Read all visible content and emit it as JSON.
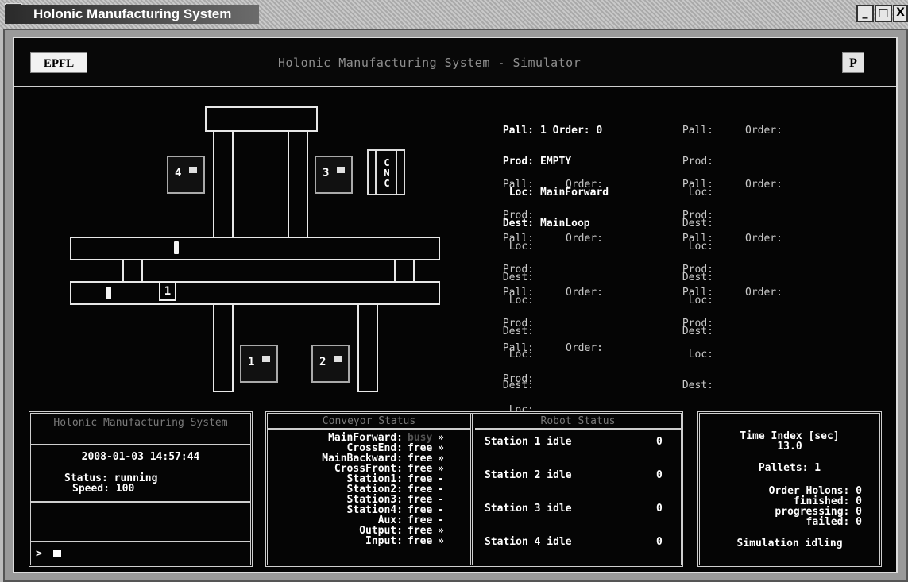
{
  "window": {
    "title": "Holonic Manufacturing System",
    "app_icon": "C:\\",
    "buttons": [
      "_",
      "□",
      "X"
    ]
  },
  "header": {
    "title": "Holonic Manufacturing System - Simulator",
    "logo_left": "EPFL",
    "logo_right": "P"
  },
  "diagram": {
    "stations": [
      "4",
      "3",
      "1",
      "2"
    ],
    "cnc": [
      "C",
      "N",
      "C"
    ],
    "pallet_label": "1"
  },
  "pallets": [
    {
      "pall": "1",
      "order": "0",
      "prod": "EMPTY",
      "loc": "MainForward",
      "dest": "MainLoop"
    },
    {
      "pall": "",
      "order": "",
      "prod": "",
      "loc": "",
      "dest": ""
    },
    {
      "pall": "",
      "order": "",
      "prod": "",
      "loc": "",
      "dest": ""
    },
    {
      "pall": "",
      "order": "",
      "prod": "",
      "loc": "",
      "dest": ""
    },
    {
      "pall": "",
      "order": "",
      "prod": "",
      "loc": "",
      "dest": ""
    },
    {
      "pall": "",
      "order": "",
      "prod": "",
      "loc": "",
      "dest": ""
    },
    {
      "pall": "",
      "order": "",
      "prod": "",
      "loc": "",
      "dest": ""
    },
    {
      "pall": "",
      "order": "",
      "prod": "",
      "loc": "",
      "dest": ""
    },
    {
      "pall": "",
      "order": "",
      "prod": "",
      "loc": "",
      "dest": ""
    }
  ],
  "pallet_labels": {
    "pall": "Pall:",
    "order": "Order:",
    "prod": "Prod:",
    "loc": "Loc:",
    "dest": "Dest:"
  },
  "system_panel": {
    "title": "Holonic Manufacturing System",
    "datetime": "2008-01-03 14:57:44",
    "status_label": "Status:",
    "status": "running",
    "speed_label": "Speed:",
    "speed": "100",
    "prompt": ">"
  },
  "conveyor_panel": {
    "title": "Conveyor Status",
    "rows": [
      {
        "name": "MainForward:",
        "state": "busy",
        "arrow": "»"
      },
      {
        "name": "CrossEnd:",
        "state": "free",
        "arrow": "»"
      },
      {
        "name": "MainBackward:",
        "state": "free",
        "arrow": "»"
      },
      {
        "name": "CrossFront:",
        "state": "free",
        "arrow": "»"
      },
      {
        "name": "Station1:",
        "state": "free",
        "arrow": "-"
      },
      {
        "name": "Station2:",
        "state": "free",
        "arrow": "-"
      },
      {
        "name": "Station3:",
        "state": "free",
        "arrow": "-"
      },
      {
        "name": "Station4:",
        "state": "free",
        "arrow": "-"
      },
      {
        "name": "Aux:",
        "state": "free",
        "arrow": "-"
      },
      {
        "name": "Output:",
        "state": "free",
        "arrow": "»"
      },
      {
        "name": "Input:",
        "state": "free",
        "arrow": "»"
      }
    ]
  },
  "robot_panel": {
    "title": "Robot Status",
    "rows": [
      {
        "label": "Station 1 idle",
        "count": "0"
      },
      {
        "label": "Station 2 idle",
        "count": "0"
      },
      {
        "label": "Station 3 idle",
        "count": "0"
      },
      {
        "label": "Station 4 idle",
        "count": "0"
      }
    ]
  },
  "stats_panel": {
    "time_label": "Time Index [sec]",
    "time_value": "13.0",
    "pallets": "Pallets: 1",
    "order_holons": "Order Holons: 0",
    "finished": "finished: 0",
    "progressing": "progressing: 0",
    "failed": "failed: 0",
    "sim_status": "Simulation idling"
  }
}
